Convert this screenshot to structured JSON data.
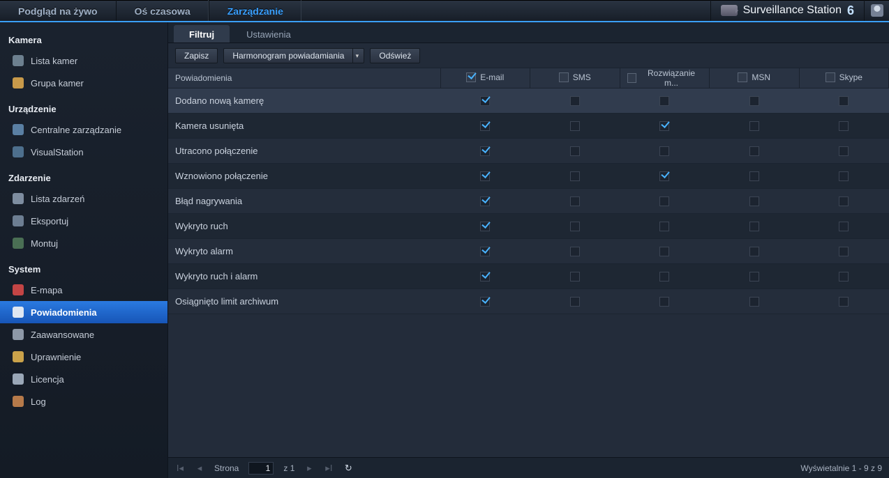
{
  "brand": {
    "name": "Surveillance Station",
    "ver": "6"
  },
  "topTabs": [
    {
      "label": "Podgląd na żywo",
      "active": false
    },
    {
      "label": "Oś czasowa",
      "active": false
    },
    {
      "label": "Zarządzanie",
      "active": true
    }
  ],
  "sidebar": [
    {
      "type": "head",
      "label": "Kamera"
    },
    {
      "type": "item",
      "label": "Lista kamer",
      "icon": "#6d808f"
    },
    {
      "type": "item",
      "label": "Grupa kamer",
      "icon": "#c89a4a"
    },
    {
      "type": "head",
      "label": "Urządzenie"
    },
    {
      "type": "item",
      "label": "Centralne zarządzanie",
      "icon": "#5a7fa3"
    },
    {
      "type": "item",
      "label": "VisualStation",
      "icon": "#4d6f8d"
    },
    {
      "type": "head",
      "label": "Zdarzenie"
    },
    {
      "type": "item",
      "label": "Lista zdarzeń",
      "icon": "#7e8da0"
    },
    {
      "type": "item",
      "label": "Eksportuj",
      "icon": "#6d7e92"
    },
    {
      "type": "item",
      "label": "Montuj",
      "icon": "#4a6f54"
    },
    {
      "type": "head",
      "label": "System"
    },
    {
      "type": "item",
      "label": "E-mapa",
      "icon": "#c34545"
    },
    {
      "type": "item",
      "label": "Powiadomienia",
      "icon": "#dfe7f2",
      "active": true
    },
    {
      "type": "item",
      "label": "Zaawansowane",
      "icon": "#8d98a7"
    },
    {
      "type": "item",
      "label": "Uprawnienie",
      "icon": "#caa24a"
    },
    {
      "type": "item",
      "label": "Licencja",
      "icon": "#9aa7b7"
    },
    {
      "type": "item",
      "label": "Log",
      "icon": "#b67a4a"
    }
  ],
  "subTabs": [
    {
      "label": "Filtruj",
      "active": true
    },
    {
      "label": "Ustawienia",
      "active": false
    }
  ],
  "toolbar": {
    "save": "Zapisz",
    "combo": "Harmonogram powiadamiania",
    "refresh": "Odśwież"
  },
  "columns": {
    "name": "Powiadomienia",
    "cols": [
      {
        "label": "E-mail",
        "hdrChecked": true
      },
      {
        "label": "SMS",
        "hdrChecked": false
      },
      {
        "label": "Rozwiązanie m...",
        "hdrChecked": false
      },
      {
        "label": "MSN",
        "hdrChecked": false
      },
      {
        "label": "Skype",
        "hdrChecked": false
      }
    ]
  },
  "rows": [
    {
      "name": "Dodano nową kamerę",
      "v": [
        true,
        false,
        false,
        false,
        false
      ],
      "sel": true
    },
    {
      "name": "Kamera usunięta",
      "v": [
        true,
        false,
        true,
        false,
        false
      ]
    },
    {
      "name": "Utracono połączenie",
      "v": [
        true,
        false,
        false,
        false,
        false
      ]
    },
    {
      "name": "Wznowiono połączenie",
      "v": [
        true,
        false,
        true,
        false,
        false
      ]
    },
    {
      "name": "Błąd nagrywania",
      "v": [
        true,
        false,
        false,
        false,
        false
      ]
    },
    {
      "name": "Wykryto ruch",
      "v": [
        true,
        false,
        false,
        false,
        false
      ]
    },
    {
      "name": "Wykryto alarm",
      "v": [
        true,
        false,
        false,
        false,
        false
      ]
    },
    {
      "name": "Wykryto ruch i alarm",
      "v": [
        true,
        false,
        false,
        false,
        false
      ]
    },
    {
      "name": "Osiągnięto limit archiwum",
      "v": [
        true,
        false,
        false,
        false,
        false
      ]
    }
  ],
  "pager": {
    "pageLabel": "Strona",
    "pageVal": "1",
    "ofLabel": "z 1",
    "summary": "Wyświetalnie 1 - 9 z 9"
  }
}
